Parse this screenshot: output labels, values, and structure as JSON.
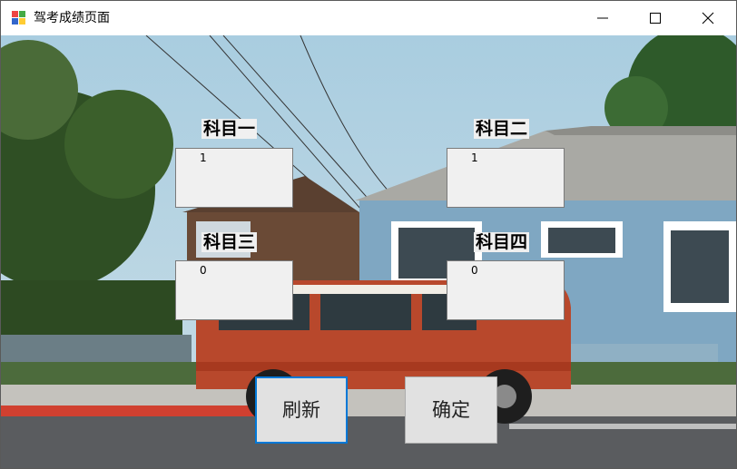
{
  "window": {
    "title": "驾考成绩页面"
  },
  "subjects": [
    {
      "label": "科目一",
      "value": "1"
    },
    {
      "label": "科目二",
      "value": "1"
    },
    {
      "label": "科目三",
      "value": "0"
    },
    {
      "label": "科目四",
      "value": "0"
    }
  ],
  "buttons": {
    "refresh": "刷新",
    "confirm": "确定"
  },
  "titlebar_icons": [
    "app-icon",
    "minimize-icon",
    "maximize-icon",
    "close-icon"
  ]
}
